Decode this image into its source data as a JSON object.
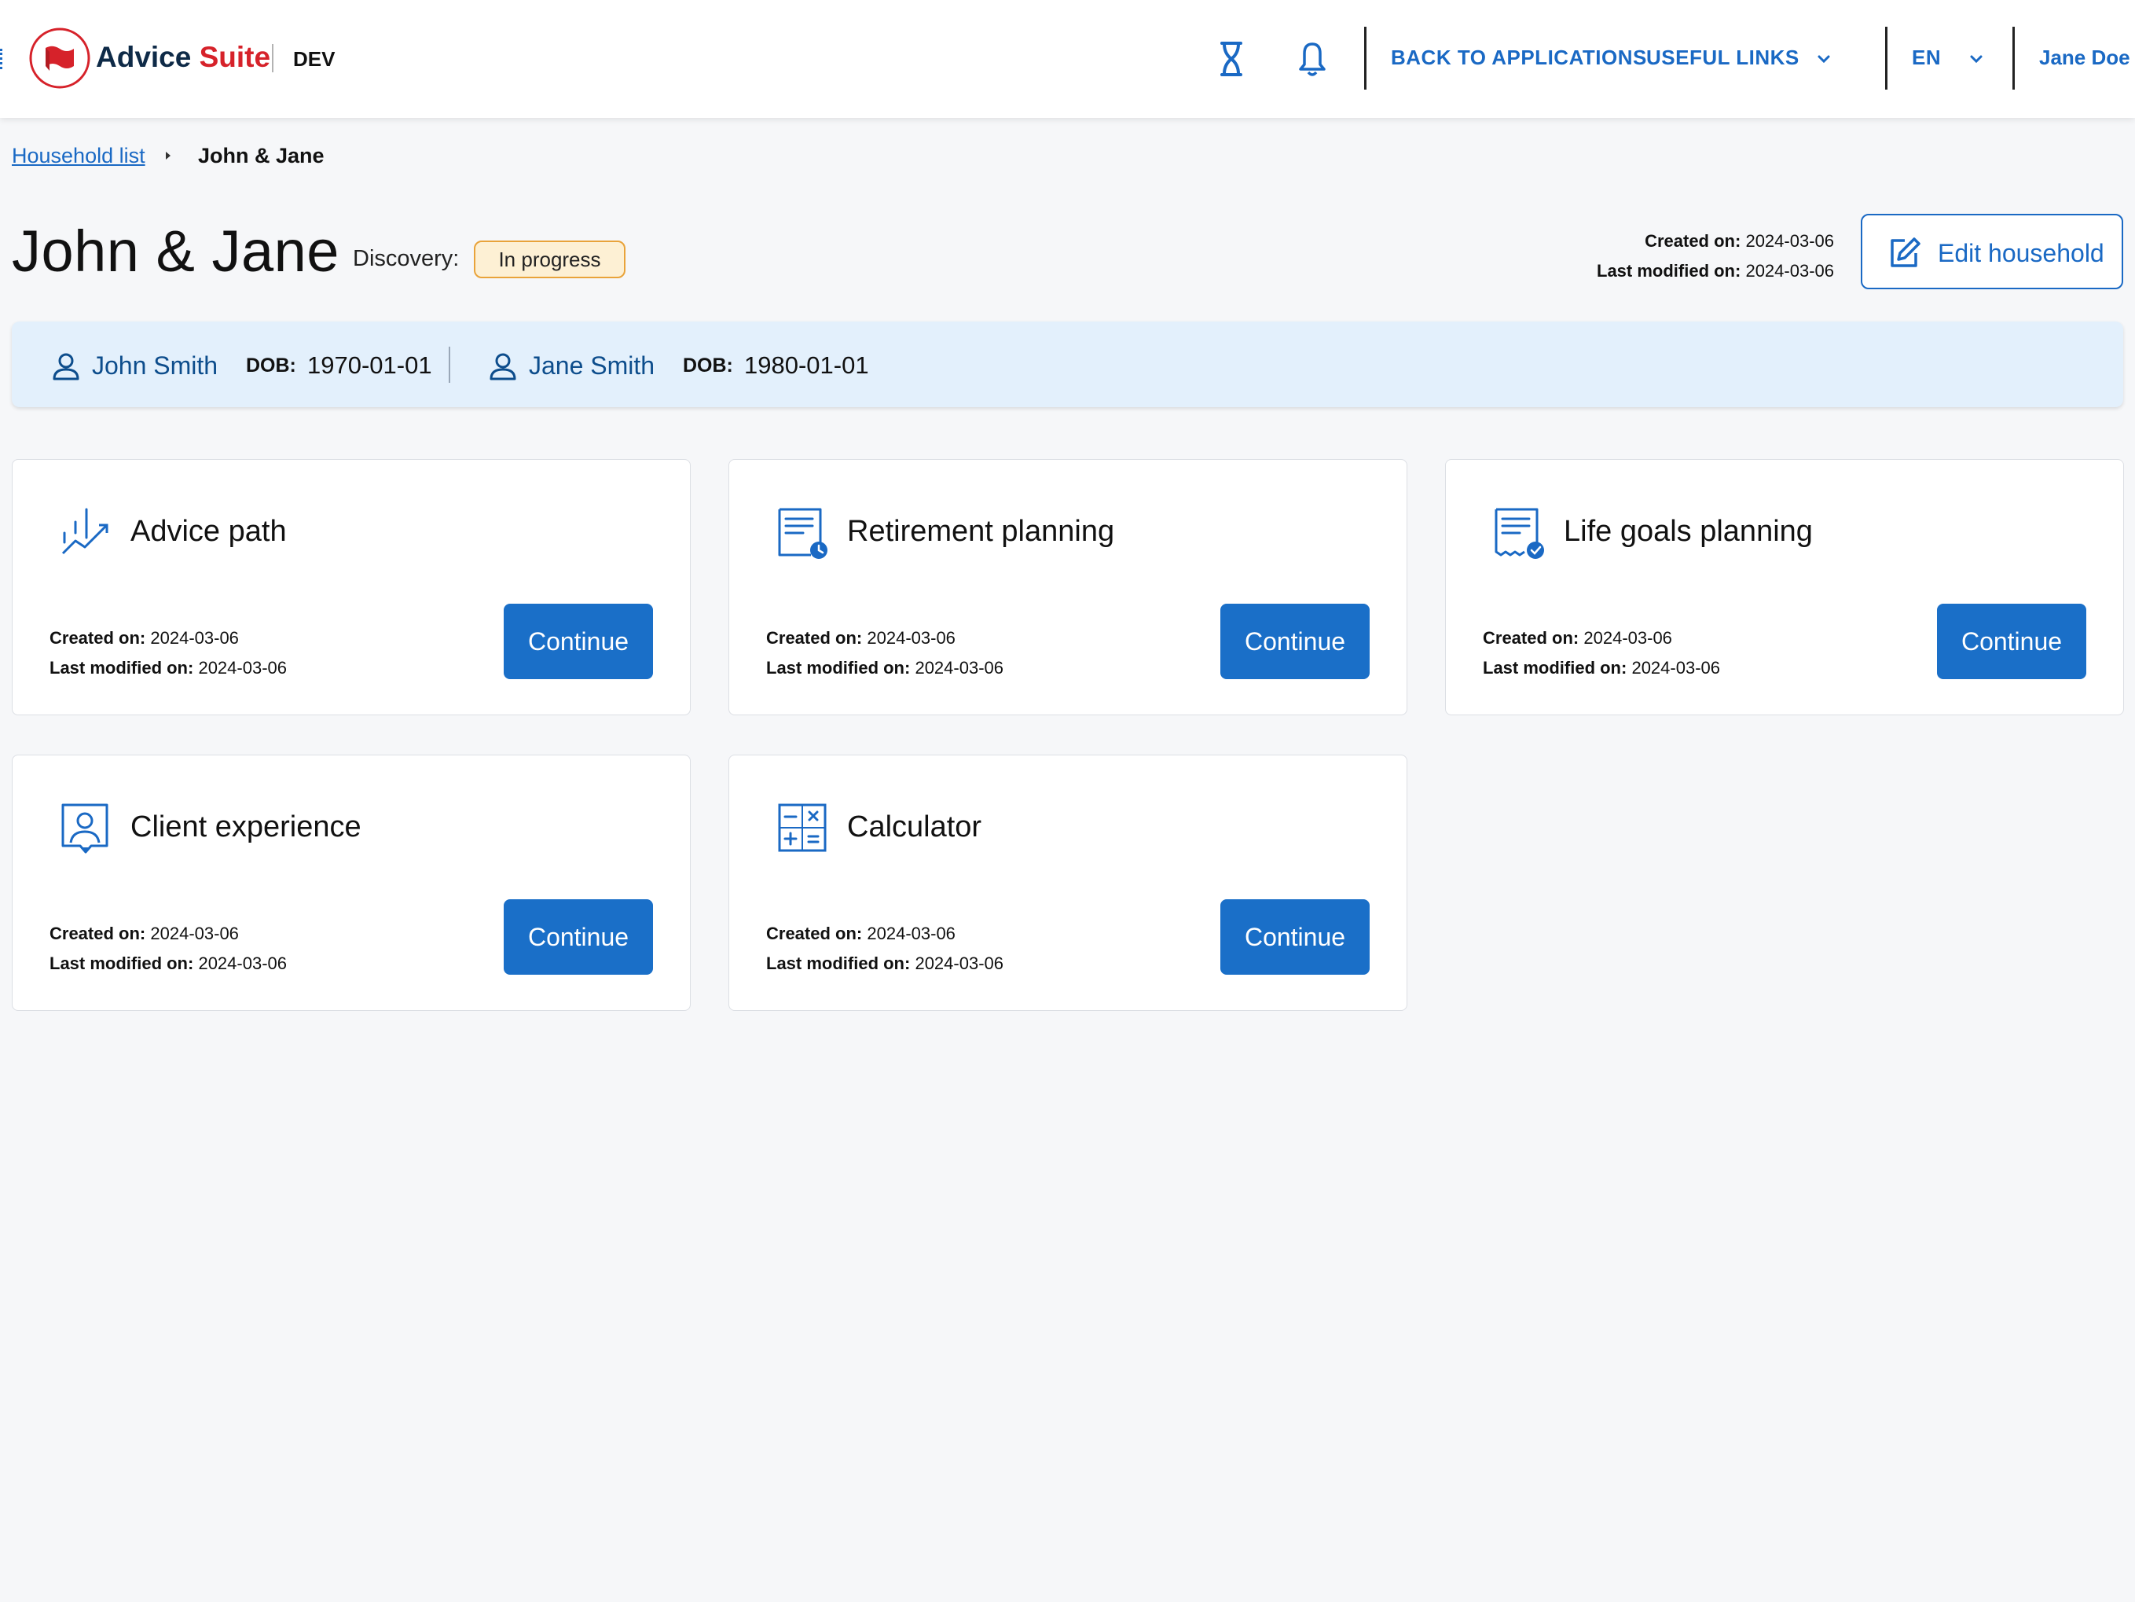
{
  "header": {
    "brand_part1": "Advice",
    "brand_part2": "Suite",
    "environment": "DEV",
    "back_to_applications": "BACK TO APPLICATIONS",
    "useful_links": "USEFUL LINKS",
    "language": "EN",
    "user_name": "Jane Doe"
  },
  "breadcrumb": {
    "parent": "Household list",
    "current": "John & Jane"
  },
  "household": {
    "title": "John & Jane",
    "discovery_label": "Discovery:",
    "status": "In progress",
    "created_label": "Created on:",
    "created_value": "2024-03-06",
    "modified_label": "Last modified on:",
    "modified_value": "2024-03-06",
    "edit_label": "Edit household"
  },
  "members": [
    {
      "name": "John Smith",
      "dob_label": "DOB:",
      "dob": "1970-01-01"
    },
    {
      "name": "Jane Smith",
      "dob_label": "DOB:",
      "dob": "1980-01-01"
    }
  ],
  "cards": [
    {
      "title": "Advice path",
      "icon": "chart-trend-icon",
      "created_label": "Created on:",
      "created": "2024-03-06",
      "modified_label": "Last modified on:",
      "modified": "2024-03-06",
      "button": "Continue"
    },
    {
      "title": "Retirement planning",
      "icon": "document-clock-icon",
      "created_label": "Created on:",
      "created": "2024-03-06",
      "modified_label": "Last modified on:",
      "modified": "2024-03-06",
      "button": "Continue"
    },
    {
      "title": "Life goals planning",
      "icon": "document-check-icon",
      "created_label": "Created on:",
      "created": "2024-03-06",
      "modified_label": "Last modified on:",
      "modified": "2024-03-06",
      "button": "Continue"
    },
    {
      "title": "Client experience",
      "icon": "client-profile-icon",
      "created_label": "Created on:",
      "created": "2024-03-06",
      "modified_label": "Last modified on:",
      "modified": "2024-03-06",
      "button": "Continue"
    },
    {
      "title": "Calculator",
      "icon": "calculator-icon",
      "created_label": "Created on:",
      "created": "2024-03-06",
      "modified_label": "Last modified on:",
      "modified": "2024-03-06",
      "button": "Continue"
    }
  ],
  "colors": {
    "accent": "#1a69c4",
    "brand_red": "#d6222a",
    "brand_navy": "#0e2a47",
    "status_bg": "#fdf0d4",
    "status_border": "#e9a33a",
    "members_bg": "#e3f0fc"
  }
}
